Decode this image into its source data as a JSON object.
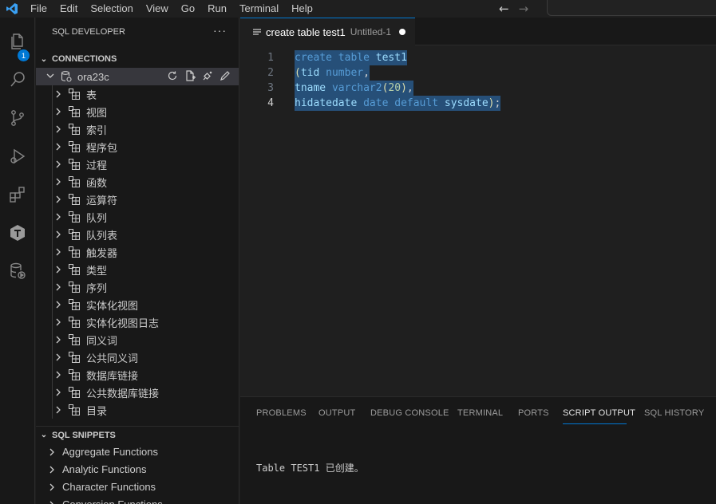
{
  "menu": [
    "File",
    "Edit",
    "Selection",
    "View",
    "Go",
    "Run",
    "Terminal",
    "Help"
  ],
  "activity": {
    "explorer_badge": "1",
    "icons": [
      "files-icon",
      "search-icon",
      "source-control-icon",
      "run-debug-icon",
      "extensions-icon",
      "sql-developer-icon",
      "database-icon"
    ]
  },
  "sidebar": {
    "title": "SQL DEVELOPER",
    "connections_title": "CONNECTIONS",
    "connection": "ora23c",
    "tree": [
      "表",
      "视图",
      "索引",
      "程序包",
      "过程",
      "函数",
      "运算符",
      "队列",
      "队列表",
      "触发器",
      "类型",
      "序列",
      "实体化视图",
      "实体化视图日志",
      "同义词",
      "公共同义词",
      "数据库链接",
      "公共数据库链接",
      "目录"
    ],
    "snippets_title": "SQL SNIPPETS",
    "snippets": [
      "Aggregate Functions",
      "Analytic Functions",
      "Character Functions",
      "Conversion Functions"
    ]
  },
  "editor": {
    "tab_name": "create table test1",
    "tab_desc": "Untitled-1",
    "line_numbers": [
      "1",
      "2",
      "3",
      "4"
    ],
    "lines": [
      [
        {
          "t": "create",
          "c": "kw"
        },
        {
          "t": " ",
          "c": "pn"
        },
        {
          "t": "table",
          "c": "kw"
        },
        {
          "t": " ",
          "c": "pn"
        },
        {
          "t": "test1",
          "c": "id"
        }
      ],
      [
        {
          "t": "(",
          "c": "fn"
        },
        {
          "t": "tid",
          "c": "id"
        },
        {
          "t": " ",
          "c": "pn"
        },
        {
          "t": "number",
          "c": "kw"
        },
        {
          "t": ",",
          "c": "pn"
        }
      ],
      [
        {
          "t": "tname",
          "c": "id"
        },
        {
          "t": " ",
          "c": "pn"
        },
        {
          "t": "varchar2",
          "c": "kw"
        },
        {
          "t": "(",
          "c": "fn"
        },
        {
          "t": "20",
          "c": "num"
        },
        {
          "t": ")",
          "c": "fn"
        },
        {
          "t": ",",
          "c": "pn"
        }
      ],
      [
        {
          "t": "hidatedate",
          "c": "id"
        },
        {
          "t": " ",
          "c": "pn"
        },
        {
          "t": "date",
          "c": "kw"
        },
        {
          "t": " ",
          "c": "pn"
        },
        {
          "t": "default",
          "c": "kw"
        },
        {
          "t": " ",
          "c": "pn"
        },
        {
          "t": "sysdate",
          "c": "id"
        },
        {
          "t": ")",
          "c": "fn"
        },
        {
          "t": ";",
          "c": "pn"
        }
      ]
    ]
  },
  "panel": {
    "tabs": [
      "PROBLEMS",
      "OUTPUT",
      "DEBUG CONSOLE",
      "TERMINAL",
      "PORTS",
      "SCRIPT OUTPUT",
      "SQL HISTORY"
    ],
    "active_tab": "SCRIPT OUTPUT",
    "output": "Table TEST1 已创建。"
  },
  "colors": {
    "accent": "#0078d4",
    "selection": "#264f78"
  }
}
